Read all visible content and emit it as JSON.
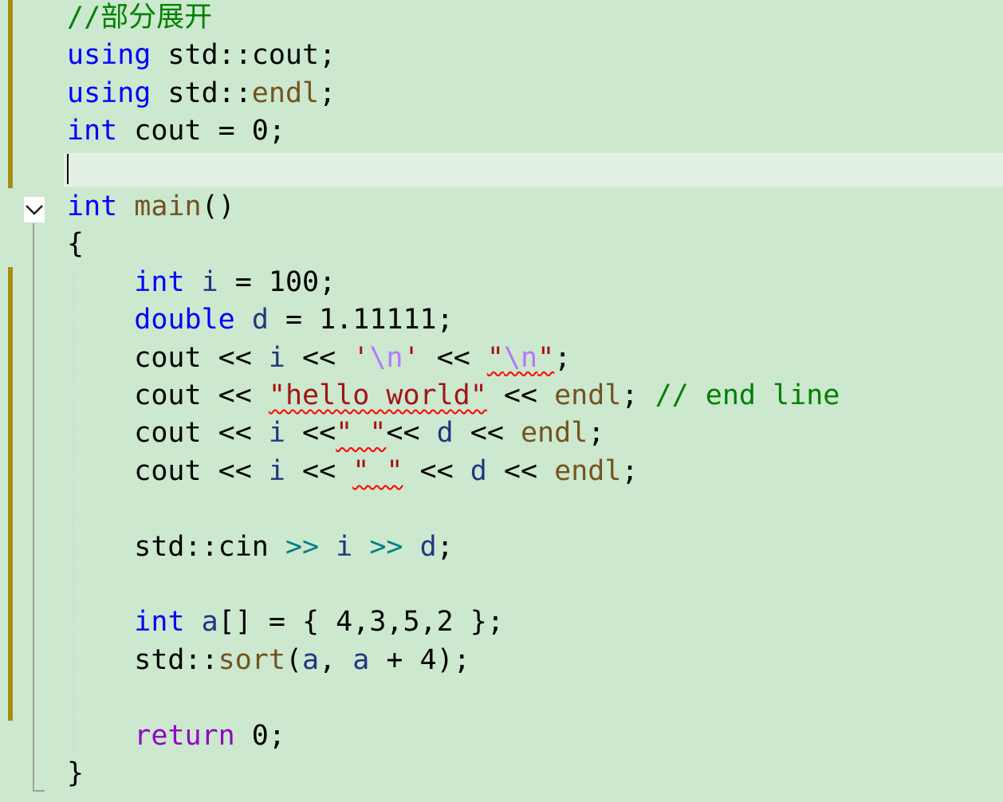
{
  "editor": {
    "lines": [
      [
        {
          "t": "//部分展开",
          "c": "cmt"
        }
      ],
      [
        {
          "t": "using",
          "c": "kw"
        },
        {
          "t": " std::cout;",
          "c": ""
        }
      ],
      [
        {
          "t": "using",
          "c": "kw"
        },
        {
          "t": " std::",
          "c": ""
        },
        {
          "t": "endl",
          "c": "fn"
        },
        {
          "t": ";",
          "c": ""
        }
      ],
      [
        {
          "t": "int",
          "c": "kw"
        },
        {
          "t": " cout = 0;",
          "c": ""
        }
      ],
      [
        {
          "t": "",
          "c": ""
        }
      ],
      [
        {
          "t": "int",
          "c": "kw"
        },
        {
          "t": " ",
          "c": ""
        },
        {
          "t": "main",
          "c": "fn"
        },
        {
          "t": "()",
          "c": ""
        }
      ],
      [
        {
          "t": "{",
          "c": ""
        }
      ],
      [
        {
          "t": "    ",
          "c": ""
        },
        {
          "t": "int",
          "c": "kw"
        },
        {
          "t": " ",
          "c": ""
        },
        {
          "t": "i",
          "c": "var"
        },
        {
          "t": " = 100;",
          "c": ""
        }
      ],
      [
        {
          "t": "    ",
          "c": ""
        },
        {
          "t": "double",
          "c": "kw"
        },
        {
          "t": " ",
          "c": ""
        },
        {
          "t": "d",
          "c": "var"
        },
        {
          "t": " = 1.11111;",
          "c": ""
        }
      ],
      [
        {
          "t": "    cout << ",
          "c": ""
        },
        {
          "t": "i",
          "c": "var"
        },
        {
          "t": " << ",
          "c": ""
        },
        {
          "t": "'",
          "c": "str"
        },
        {
          "t": "\\n",
          "c": "esc"
        },
        {
          "t": "'",
          "c": "str"
        },
        {
          "t": " << ",
          "c": ""
        },
        {
          "t": "\"",
          "c": "str err"
        },
        {
          "t": "\\n",
          "c": "esc err"
        },
        {
          "t": "\"",
          "c": "str err"
        },
        {
          "t": ";",
          "c": ""
        }
      ],
      [
        {
          "t": "    cout << ",
          "c": ""
        },
        {
          "t": "\"hello world\"",
          "c": "str err"
        },
        {
          "t": " << ",
          "c": ""
        },
        {
          "t": "endl",
          "c": "fn"
        },
        {
          "t": "; ",
          "c": ""
        },
        {
          "t": "// end line",
          "c": "cmt"
        }
      ],
      [
        {
          "t": "    cout << ",
          "c": ""
        },
        {
          "t": "i",
          "c": "var"
        },
        {
          "t": " <<",
          "c": ""
        },
        {
          "t": "\" \"",
          "c": "str err"
        },
        {
          "t": "<< ",
          "c": ""
        },
        {
          "t": "d",
          "c": "var"
        },
        {
          "t": " << ",
          "c": ""
        },
        {
          "t": "endl",
          "c": "fn"
        },
        {
          "t": ";",
          "c": ""
        }
      ],
      [
        {
          "t": "    cout << ",
          "c": ""
        },
        {
          "t": "i",
          "c": "var"
        },
        {
          "t": " << ",
          "c": ""
        },
        {
          "t": "\" \"",
          "c": "str err"
        },
        {
          "t": " << ",
          "c": ""
        },
        {
          "t": "d",
          "c": "var"
        },
        {
          "t": " << ",
          "c": ""
        },
        {
          "t": "endl",
          "c": "fn"
        },
        {
          "t": ";",
          "c": ""
        }
      ],
      [
        {
          "t": "",
          "c": ""
        }
      ],
      [
        {
          "t": "    std::cin ",
          "c": ""
        },
        {
          "t": ">>",
          "c": "op2"
        },
        {
          "t": " ",
          "c": ""
        },
        {
          "t": "i",
          "c": "var"
        },
        {
          "t": " ",
          "c": ""
        },
        {
          "t": ">>",
          "c": "op2"
        },
        {
          "t": " ",
          "c": ""
        },
        {
          "t": "d",
          "c": "var"
        },
        {
          "t": ";",
          "c": ""
        }
      ],
      [
        {
          "t": "",
          "c": ""
        }
      ],
      [
        {
          "t": "    ",
          "c": ""
        },
        {
          "t": "int",
          "c": "kw"
        },
        {
          "t": " ",
          "c": ""
        },
        {
          "t": "a",
          "c": "var"
        },
        {
          "t": "[] = { 4,3,5,2 };",
          "c": ""
        }
      ],
      [
        {
          "t": "    std::",
          "c": ""
        },
        {
          "t": "sort",
          "c": "fn"
        },
        {
          "t": "(",
          "c": ""
        },
        {
          "t": "a",
          "c": "var"
        },
        {
          "t": ", ",
          "c": ""
        },
        {
          "t": "a",
          "c": "var"
        },
        {
          "t": " + 4);",
          "c": ""
        }
      ],
      [
        {
          "t": "",
          "c": ""
        }
      ],
      [
        {
          "t": "    ",
          "c": ""
        },
        {
          "t": "return",
          "c": "ret"
        },
        {
          "t": " 0;",
          "c": ""
        }
      ],
      [
        {
          "t": "}",
          "c": ""
        }
      ]
    ]
  },
  "colors": {
    "background": "#cce8cf",
    "keyword": "#0000ff",
    "function": "#74531f",
    "variable": "#1f377f",
    "string": "#a31515",
    "escape": "#b776fb",
    "comment": "#008000",
    "return_keyword": "#8f08c4",
    "error_squiggle": "#ff0000",
    "change_marker": "#a48e11"
  },
  "gutter": {
    "fold_icon": "chevron-down-icon"
  }
}
